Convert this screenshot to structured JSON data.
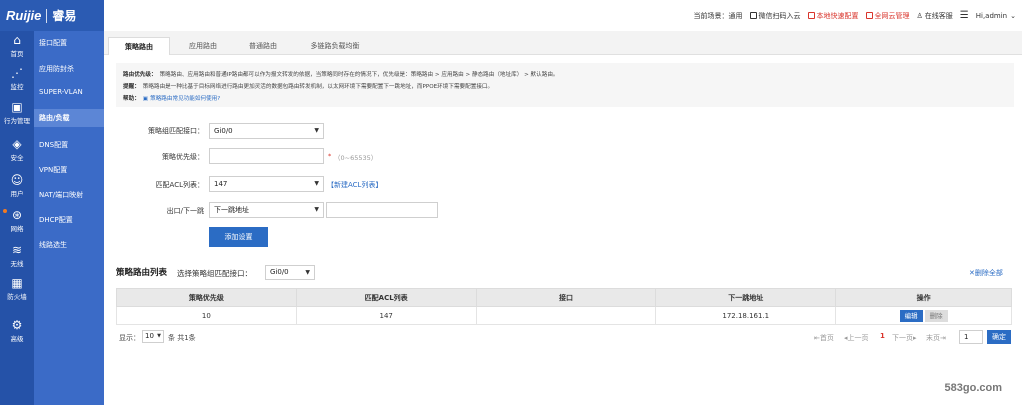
{
  "brand": {
    "logo_text": "Ruijie",
    "logo_cn": "睿易"
  },
  "topbar": {
    "scene_label": "当前场景：",
    "scene_value": "通用",
    "wechat": "微信扫码入云",
    "quick_config": "本地快速配置",
    "cloud_manage": "全网云管理",
    "online_service": "在线客服",
    "user": "Hi,admin"
  },
  "icon_rail": [
    {
      "icon": "home-icon",
      "glyph": "⌂",
      "label": "首页"
    },
    {
      "icon": "chart-icon",
      "glyph": "⋰",
      "label": "监控"
    },
    {
      "icon": "behavior-icon",
      "glyph": "▣",
      "label": "行为管理"
    },
    {
      "icon": "shield-icon",
      "glyph": "◈",
      "label": "安全"
    },
    {
      "icon": "user-icon",
      "glyph": "☺",
      "label": "用户"
    },
    {
      "icon": "network-icon",
      "glyph": "⊛",
      "label": "网络"
    },
    {
      "icon": "wifi-icon",
      "glyph": "≋",
      "label": "无线"
    },
    {
      "icon": "firewall-icon",
      "glyph": "▦",
      "label": "防火墙"
    },
    {
      "icon": "gear-icon",
      "glyph": "⚙",
      "label": "高级"
    }
  ],
  "submenu": [
    "接口配置",
    "应用防封杀",
    "SUPER-VLAN",
    "路由/负载",
    "DNS配置",
    "VPN配置",
    "NAT/端口映射",
    "DHCP配置",
    "线路选生"
  ],
  "tabs": [
    "策略路由",
    "应用路由",
    "普通路由",
    "多链路负载均衡"
  ],
  "info": {
    "priority_label": "路由优先级：",
    "priority_text": "策略路由、应用路由和普通IP路由都可以作为报文转发的依据，当策略同时存在的情况下，优先级是：策略路由 > 应用路由 > 静态路由（地址库） > 默认路由。",
    "note_label": "提醒：",
    "note_text": "策略路由是一种比基于目标网络进行路由更加灵活的数据包路由转发机制，以太网环境下需要配置下一跳地址，而PPOE环境下需要配置接口。",
    "help_label": "帮助：",
    "help_link": "策略路由常见功能如何使用?"
  },
  "form": {
    "iface_label": "策略组匹配接口：",
    "iface_value": "Gi0/0",
    "prio_label": "策略优先级：",
    "prio_value": "",
    "prio_hint": "（0~65535）",
    "acl_label": "匹配ACL列表：",
    "acl_value": "147",
    "acl_new": "【新建ACL列表】",
    "exit_label": "出口/下一跳",
    "exit_value": "下一跳地址",
    "nexthop_value": "",
    "add_button": "添加设置"
  },
  "list": {
    "title": "策略路由列表",
    "select_label": "选择策略组匹配接口：",
    "select_value": "Gi0/0",
    "delete_all": "删除全部",
    "columns": [
      "策略优先级",
      "匹配ACL列表",
      "接口",
      "下一跳地址",
      "操作"
    ],
    "rows": [
      {
        "priority": "10",
        "acl": "147",
        "iface": "",
        "nexthop": "172.18.161.1",
        "edit": "编辑",
        "delete": "删除"
      }
    ]
  },
  "pager": {
    "show_label": "显示：",
    "page_size": "10",
    "total": "条 共1条",
    "first": "首页",
    "prev": "上一页",
    "current": "1",
    "next": "下一页",
    "last": "末页",
    "goto_value": "1",
    "confirm": "确定"
  },
  "watermark": "583go.com"
}
